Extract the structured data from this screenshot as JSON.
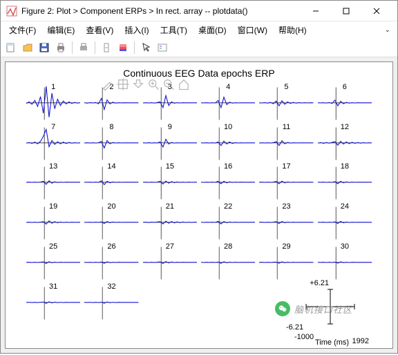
{
  "window": {
    "title": "Figure 2: Plot > Component ERPs > In rect. array -- plotdata()"
  },
  "menubar": {
    "items": [
      "文件(F)",
      "编辑(E)",
      "查看(V)",
      "插入(I)",
      "工具(T)",
      "桌面(D)",
      "窗口(W)",
      "帮助(H)"
    ],
    "expand": "⌄"
  },
  "chart_data": {
    "type": "line",
    "title": "Continuous EEG Data epochs ERP",
    "xlabel": "Time (ms)",
    "ylabel": "",
    "xlim": [
      -1000,
      1992
    ],
    "ylim": [
      -6.21,
      6.21
    ],
    "num_components": 32,
    "grid_cols": 6,
    "grid_rows": 6,
    "series": [
      {
        "name": "1",
        "y": [
          -0.2,
          0.3,
          -0.5,
          0.8,
          -1.2,
          2.1,
          -3.5,
          5.5,
          -4.8,
          3.2,
          -2.0,
          1.2,
          -0.9,
          0.6,
          -0.4,
          0.3,
          -0.2,
          0.15,
          -0.1,
          0.08
        ]
      },
      {
        "name": "2",
        "y": [
          0.05,
          -0.1,
          0.08,
          -0.06,
          0.1,
          -0.3,
          1.5,
          -2.2,
          1.0,
          -0.4,
          0.2,
          -0.1,
          0.06,
          -0.03,
          0.02,
          -0.01,
          0.01,
          0,
          0,
          0
        ]
      },
      {
        "name": "3",
        "y": [
          -0.05,
          0.04,
          -0.06,
          0.05,
          -0.08,
          0.1,
          0.3,
          -1.6,
          2.4,
          -0.9,
          0.3,
          -0.12,
          0.06,
          -0.04,
          0.02,
          -0.01,
          0.01,
          0,
          0,
          0
        ]
      },
      {
        "name": "4",
        "y": [
          0.02,
          -0.03,
          0.04,
          -0.05,
          0.03,
          -0.04,
          0.8,
          -1.6,
          1.9,
          -0.6,
          0.2,
          -0.1,
          0.04,
          -0.02,
          0.01,
          0,
          0,
          0,
          0,
          0
        ]
      },
      {
        "name": "5",
        "y": [
          0.03,
          -0.05,
          0.08,
          -0.1,
          0.15,
          -0.3,
          0.6,
          -1.0,
          0.7,
          -0.5,
          0.3,
          -0.2,
          0.15,
          -0.1,
          0.08,
          -0.06,
          0.04,
          -0.03,
          0.02,
          -0.01
        ]
      },
      {
        "name": "6",
        "y": [
          0.02,
          -0.03,
          0.05,
          -0.08,
          0.1,
          -0.2,
          0.9,
          -1.0,
          0.5,
          -0.3,
          0.15,
          -0.1,
          0.06,
          -0.04,
          0.02,
          -0.01,
          0.01,
          0,
          0,
          0
        ]
      },
      {
        "name": "7",
        "y": [
          -0.08,
          0.12,
          -0.18,
          0.25,
          -0.3,
          0.5,
          2.2,
          4.5,
          -1.3,
          0.8,
          -0.5,
          0.4,
          -0.3,
          0.25,
          -0.2,
          0.15,
          -0.1,
          0.08,
          -0.05,
          0.04
        ]
      },
      {
        "name": "8",
        "y": [
          -0.03,
          0.04,
          -0.05,
          0.03,
          -0.04,
          0.06,
          0.5,
          -1.7,
          0.8,
          -0.3,
          0.12,
          -0.06,
          0.03,
          -0.02,
          0.01,
          0,
          0,
          0,
          0,
          0
        ]
      },
      {
        "name": "9",
        "y": [
          0.04,
          -0.06,
          0.08,
          -0.05,
          0.04,
          -0.06,
          0.3,
          -1.4,
          1.2,
          -0.4,
          0.15,
          -0.08,
          0.04,
          -0.02,
          0.01,
          0,
          0,
          0,
          0,
          0
        ]
      },
      {
        "name": "10",
        "y": [
          0.03,
          -0.03,
          0.04,
          -0.05,
          0.03,
          -0.04,
          0.3,
          -0.9,
          0.6,
          -0.4,
          0.3,
          -0.2,
          0.1,
          -0.06,
          0.04,
          -0.02,
          0.01,
          0,
          0,
          0
        ]
      },
      {
        "name": "11",
        "y": [
          -0.04,
          0.05,
          -0.06,
          0.04,
          -0.05,
          0.08,
          0.4,
          -0.9,
          0.7,
          -0.3,
          0.15,
          -0.08,
          0.04,
          -0.02,
          0.01,
          0,
          0,
          0,
          0,
          0
        ]
      },
      {
        "name": "12",
        "y": [
          -0.08,
          0.1,
          -0.15,
          0.12,
          -0.1,
          0.15,
          0.4,
          -0.8,
          0.5,
          -0.4,
          0.3,
          -0.25,
          0.2,
          -0.15,
          0.12,
          -0.1,
          0.08,
          -0.06,
          0.04,
          -0.03
        ]
      },
      {
        "name": "13",
        "y": [
          -0.03,
          0.04,
          -0.05,
          0.03,
          -0.04,
          0.05,
          0.3,
          -0.7,
          0.5,
          -0.3,
          0.15,
          -0.1,
          0.06,
          -0.04,
          0.02,
          -0.01,
          0.01,
          0,
          0,
          0
        ]
      },
      {
        "name": "14",
        "y": [
          0.02,
          -0.03,
          0.04,
          -0.05,
          0.03,
          -0.04,
          0.5,
          -0.8,
          0.3,
          -0.2,
          0.1,
          -0.06,
          0.03,
          -0.02,
          0.01,
          0,
          0,
          0,
          0,
          0
        ]
      },
      {
        "name": "15",
        "y": [
          -0.04,
          0.05,
          -0.06,
          0.04,
          -0.05,
          0.06,
          0.3,
          -0.6,
          0.4,
          -0.3,
          0.2,
          -0.15,
          0.1,
          -0.08,
          0.06,
          -0.04,
          0.03,
          -0.02,
          0.01,
          0
        ]
      },
      {
        "name": "16",
        "y": [
          0.03,
          -0.04,
          0.05,
          -0.03,
          0.04,
          -0.05,
          0.3,
          -0.5,
          0.3,
          -0.2,
          0.12,
          -0.08,
          0.05,
          -0.03,
          0.02,
          -0.01,
          0.01,
          0,
          0,
          0
        ]
      },
      {
        "name": "17",
        "y": [
          -0.03,
          0.04,
          -0.05,
          0.03,
          -0.04,
          0.05,
          0.25,
          -0.5,
          0.35,
          -0.2,
          0.1,
          -0.06,
          0.03,
          -0.02,
          0.01,
          0,
          0,
          0,
          0,
          0
        ]
      },
      {
        "name": "18",
        "y": [
          0.02,
          -0.03,
          0.04,
          -0.05,
          0.03,
          -0.04,
          0.2,
          -0.5,
          0.3,
          -0.2,
          0.12,
          -0.08,
          0.04,
          -0.02,
          0.01,
          0,
          0,
          0,
          0,
          0
        ]
      },
      {
        "name": "19",
        "y": [
          -0.04,
          0.05,
          -0.06,
          0.04,
          -0.05,
          0.06,
          0.2,
          -0.6,
          0.5,
          -0.3,
          0.2,
          -0.15,
          0.1,
          -0.08,
          0.06,
          -0.04,
          0.03,
          -0.02,
          0.01,
          0
        ]
      },
      {
        "name": "20",
        "y": [
          0.02,
          -0.03,
          0.04,
          -0.05,
          0.03,
          -0.04,
          0.15,
          -0.4,
          0.25,
          -0.15,
          0.1,
          -0.06,
          0.03,
          -0.02,
          0.01,
          0,
          0,
          0,
          0,
          0
        ]
      },
      {
        "name": "21",
        "y": [
          -0.06,
          0.08,
          -0.1,
          0.08,
          -0.06,
          0.1,
          0.2,
          -0.55,
          0.4,
          -0.3,
          0.25,
          -0.2,
          0.15,
          -0.12,
          0.1,
          -0.08,
          0.06,
          -0.04,
          0.03,
          -0.02
        ]
      },
      {
        "name": "22",
        "y": [
          0.03,
          -0.04,
          0.05,
          -0.03,
          0.04,
          -0.05,
          0.3,
          -0.55,
          0.25,
          -0.15,
          0.1,
          -0.06,
          0.03,
          -0.02,
          0.01,
          0,
          0,
          0,
          0,
          0
        ]
      },
      {
        "name": "23",
        "y": [
          -0.03,
          0.04,
          -0.05,
          0.03,
          -0.04,
          0.05,
          0.2,
          -0.4,
          0.25,
          -0.15,
          0.08,
          -0.05,
          0.03,
          -0.02,
          0.01,
          0,
          0,
          0,
          0,
          0
        ]
      },
      {
        "name": "24",
        "y": [
          0.02,
          -0.03,
          0.04,
          -0.05,
          0.03,
          -0.04,
          0.15,
          -0.4,
          0.3,
          -0.18,
          0.1,
          -0.06,
          0.03,
          -0.02,
          0.01,
          0,
          0,
          0,
          0,
          0
        ]
      },
      {
        "name": "25",
        "y": [
          -0.03,
          0.04,
          -0.05,
          0.03,
          -0.04,
          0.05,
          0.15,
          -0.35,
          0.2,
          -0.12,
          0.08,
          -0.05,
          0.03,
          -0.02,
          0.01,
          0,
          0,
          0,
          0,
          0
        ]
      },
      {
        "name": "26",
        "y": [
          0.02,
          -0.03,
          0.04,
          -0.05,
          0.03,
          -0.04,
          0.12,
          -0.3,
          0.18,
          -0.1,
          0.06,
          -0.04,
          0.02,
          -0.01,
          0.01,
          0,
          0,
          0,
          0,
          0
        ]
      },
      {
        "name": "27",
        "y": [
          -0.04,
          0.05,
          -0.06,
          0.04,
          -0.05,
          0.06,
          0.15,
          -0.35,
          0.25,
          -0.18,
          0.12,
          -0.08,
          0.05,
          -0.03,
          0.02,
          -0.01,
          0.01,
          0,
          0,
          0
        ]
      },
      {
        "name": "28",
        "y": [
          0.03,
          -0.04,
          0.05,
          -0.03,
          0.04,
          -0.05,
          0.1,
          -0.3,
          0.2,
          -0.12,
          0.08,
          -0.05,
          0.03,
          -0.02,
          0.01,
          0,
          0,
          0,
          0,
          0
        ]
      },
      {
        "name": "29",
        "y": [
          -0.03,
          0.04,
          -0.05,
          0.03,
          -0.04,
          0.05,
          0.1,
          -0.28,
          0.18,
          -0.12,
          0.08,
          -0.05,
          0.03,
          -0.02,
          0.01,
          0,
          0,
          0,
          0,
          0
        ]
      },
      {
        "name": "30",
        "y": [
          0.02,
          -0.03,
          0.04,
          -0.05,
          0.03,
          -0.04,
          0.1,
          -0.25,
          0.18,
          -0.1,
          0.06,
          -0.04,
          0.02,
          -0.01,
          0.01,
          0,
          0,
          0,
          0,
          0
        ]
      },
      {
        "name": "31",
        "y": [
          -0.03,
          0.04,
          -0.05,
          0.03,
          -0.04,
          0.05,
          0.12,
          -0.3,
          0.2,
          -0.15,
          0.1,
          -0.08,
          0.06,
          -0.04,
          0.03,
          -0.02,
          0.01,
          0,
          0,
          0
        ]
      },
      {
        "name": "32",
        "y": [
          0.02,
          -0.03,
          0.04,
          -0.05,
          0.03,
          -0.04,
          0.1,
          -0.25,
          0.15,
          -0.1,
          0.06,
          -0.04,
          0.02,
          -0.01,
          0.01,
          0,
          0,
          0,
          0,
          0
        ]
      }
    ],
    "axis_legend": {
      "ymax": "+6.21",
      "ymin": "-6.21",
      "xmin": "-1000",
      "xmax": "1992",
      "xlabel": "Time (ms)"
    }
  },
  "watermark": {
    "text": "脑机接口社区"
  }
}
